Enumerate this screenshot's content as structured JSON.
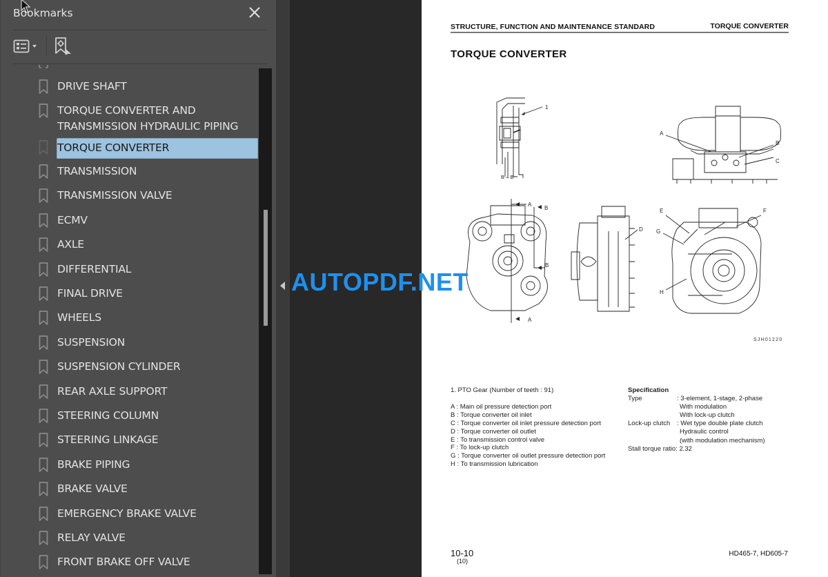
{
  "bookmarks_panel": {
    "title": "Bookmarks",
    "close_icon": "close-icon",
    "toolbar": {
      "options_icon": "list-options-icon",
      "find_icon": "find-current-bookmark-icon"
    },
    "items": [
      {
        "label": "DRIVE SHAFT",
        "selected": false
      },
      {
        "label": "TORQUE CONVERTER AND",
        "label_line2": "TRANSMISSION HYDRAULIC PIPING",
        "selected": false
      },
      {
        "label": "TORQUE CONVERTER",
        "selected": true
      },
      {
        "label": "TRANSMISSION",
        "selected": false
      },
      {
        "label": "TRANSMISSION VALVE",
        "selected": false
      },
      {
        "label": "ECMV",
        "selected": false
      },
      {
        "label": "AXLE",
        "selected": false
      },
      {
        "label": "DIFFERENTIAL",
        "selected": false
      },
      {
        "label": "FINAL DRIVE",
        "selected": false
      },
      {
        "label": "WHEELS",
        "selected": false
      },
      {
        "label": "SUSPENSION",
        "selected": false
      },
      {
        "label": "SUSPENSION CYLINDER",
        "selected": false
      },
      {
        "label": "REAR AXLE SUPPORT",
        "selected": false
      },
      {
        "label": "STEERING COLUMN",
        "selected": false
      },
      {
        "label": "STEERING LINKAGE",
        "selected": false
      },
      {
        "label": "BRAKE PIPING",
        "selected": false
      },
      {
        "label": "BRAKE VALVE",
        "selected": false
      },
      {
        "label": "EMERGENCY BRAKE VALVE",
        "selected": false
      },
      {
        "label": "RELAY VALVE",
        "selected": false
      },
      {
        "label": "FRONT BRAKE OFF VALVE",
        "selected": false
      }
    ]
  },
  "viewer": {
    "watermark": "AUTOPDF.NET",
    "page": {
      "header_left": "STRUCTURE, FUNCTION AND MAINTENANCE STANDARD",
      "header_right": "TORQUE CONVERTER",
      "title": "TORQUE CONVERTER",
      "figure": {
        "section_label": "B – B",
        "callouts": [
          "1",
          "A",
          "B",
          "C",
          "D",
          "E",
          "F",
          "G",
          "H"
        ],
        "figure_code": "SJH01220"
      },
      "legend": {
        "part": "1. PTO Gear (Number of teeth : 91)",
        "ports": [
          "A : Main oil pressure detection port",
          "B : Torque converter oil inlet",
          "C : Torque converter oil inlet pressure detection port",
          "D : Torque converter oil outlet",
          "E : To transmission control valve",
          "F : To lock-up clutch",
          "G : Torque converter oil outlet pressure detection port",
          "H : To transmission lubrication"
        ]
      },
      "specification": {
        "title": "Specification",
        "type_key": "Type",
        "type_values": [
          "3-element, 1-stage, 2-phase",
          "With modulation",
          "With lock-up clutch"
        ],
        "lockup_key": "Lock-up clutch",
        "lockup_values": [
          "Wet type double plate clutch",
          "Hydraulic control",
          "(with modulation mechanism)"
        ],
        "stall": "Stall torque ratio: 2.32"
      },
      "page_number": "10-10",
      "page_sub": "(10)",
      "model": "HD465-7, HD605-7"
    }
  }
}
